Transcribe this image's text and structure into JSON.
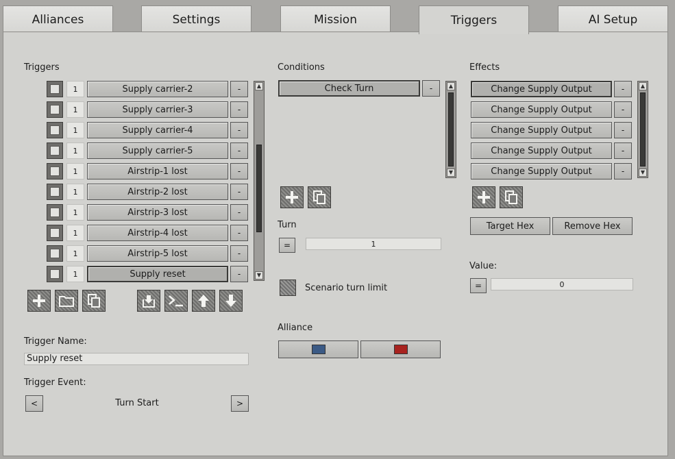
{
  "tabs": [
    "Alliances",
    "Settings",
    "Mission",
    "Triggers",
    "AI Setup"
  ],
  "active_tab": "Triggers",
  "triggers": {
    "heading": "Triggers",
    "items": [
      {
        "priority": "1",
        "name": "Supply carrier-2",
        "remove": "-"
      },
      {
        "priority": "1",
        "name": "Supply carrier-3",
        "remove": "-"
      },
      {
        "priority": "1",
        "name": "Supply carrier-4",
        "remove": "-"
      },
      {
        "priority": "1",
        "name": "Supply carrier-5",
        "remove": "-"
      },
      {
        "priority": "1",
        "name": "Airstrip-1 lost",
        "remove": "-"
      },
      {
        "priority": "1",
        "name": "Airstrip-2 lost",
        "remove": "-"
      },
      {
        "priority": "1",
        "name": "Airstrip-3 lost",
        "remove": "-"
      },
      {
        "priority": "1",
        "name": "Airstrip-4 lost",
        "remove": "-"
      },
      {
        "priority": "1",
        "name": "Airstrip-5 lost",
        "remove": "-"
      },
      {
        "priority": "1",
        "name": "Supply reset",
        "remove": "-"
      }
    ],
    "selected_index": 9,
    "trigger_name_label": "Trigger Name:",
    "trigger_name_value": "Supply reset",
    "trigger_event_label": "Trigger Event:",
    "trigger_event_value": "Turn Start",
    "prev_label": "<",
    "next_label": ">"
  },
  "conditions": {
    "heading": "Conditions",
    "items": [
      {
        "name": "Check Turn",
        "remove": "-"
      }
    ],
    "turn_label": "Turn",
    "turn_operator": "=",
    "turn_value": "1",
    "scenario_turn_limit_label": "Scenario turn limit",
    "alliance_label": "Alliance",
    "alliance_colors": [
      "#3b5a85",
      "#a8231f"
    ]
  },
  "effects": {
    "heading": "Effects",
    "items": [
      {
        "name": "Change Supply Output",
        "remove": "-"
      },
      {
        "name": "Change Supply Output",
        "remove": "-"
      },
      {
        "name": "Change Supply Output",
        "remove": "-"
      },
      {
        "name": "Change Supply Output",
        "remove": "-"
      },
      {
        "name": "Change Supply Output",
        "remove": "-"
      }
    ],
    "target_hex_label": "Target Hex",
    "remove_hex_label": "Remove Hex",
    "value_label": "Value:",
    "value_operator": "=",
    "value": "0"
  }
}
